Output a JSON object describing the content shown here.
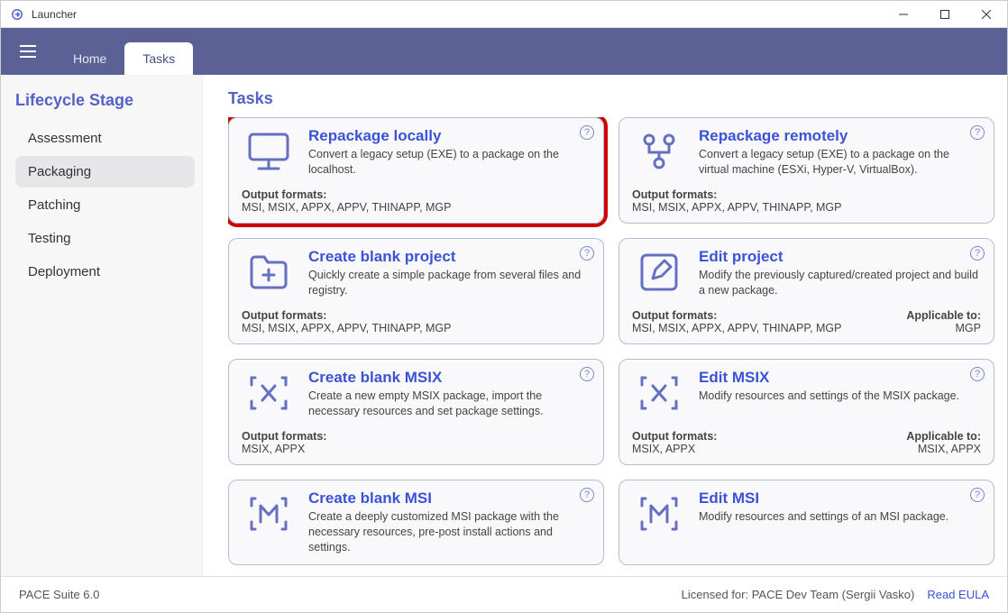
{
  "window": {
    "title": "Launcher"
  },
  "tabs": {
    "home": "Home",
    "tasks": "Tasks"
  },
  "sidebar": {
    "title": "Lifecycle Stage",
    "items": [
      {
        "label": "Assessment"
      },
      {
        "label": "Packaging"
      },
      {
        "label": "Patching"
      },
      {
        "label": "Testing"
      },
      {
        "label": "Deployment"
      }
    ]
  },
  "main": {
    "title": "Tasks",
    "labels": {
      "outputFormats": "Output formats:",
      "applicableTo": "Applicable to:"
    },
    "cards": [
      {
        "title": "Repackage locally",
        "desc": "Convert a legacy setup (EXE) to a package on the localhost.",
        "outputFormats": "MSI, MSIX, APPX, APPV, THINAPP, MGP",
        "applicableTo": ""
      },
      {
        "title": "Repackage remotely",
        "desc": "Convert a legacy setup (EXE) to a package on the virtual machine (ESXi, Hyper-V, VirtualBox).",
        "outputFormats": "MSI, MSIX, APPX, APPV, THINAPP, MGP",
        "applicableTo": ""
      },
      {
        "title": "Create blank project",
        "desc": "Quickly create a simple package from several files and registry.",
        "outputFormats": "MSI, MSIX, APPX, APPV, THINAPP, MGP",
        "applicableTo": ""
      },
      {
        "title": "Edit project",
        "desc": "Modify the previously captured/created project and build a new package.",
        "outputFormats": "MSI, MSIX, APPX, APPV, THINAPP, MGP",
        "applicableTo": "MGP"
      },
      {
        "title": "Create blank MSIX",
        "desc": "Create a new empty MSIX package, import the necessary resources and set package settings.",
        "outputFormats": "MSIX, APPX",
        "applicableTo": ""
      },
      {
        "title": "Edit MSIX",
        "desc": "Modify resources and settings of the MSIX package.",
        "outputFormats": "MSIX, APPX",
        "applicableTo": "MSIX, APPX"
      },
      {
        "title": "Create blank MSI",
        "desc": "Create a deeply customized MSI package with the necessary resources, pre-post install actions and settings.",
        "outputFormats": "",
        "applicableTo": ""
      },
      {
        "title": "Edit MSI",
        "desc": "Modify resources and settings of an MSI package.",
        "outputFormats": "",
        "applicableTo": ""
      }
    ]
  },
  "footer": {
    "version": "PACE Suite 6.0",
    "license": "Licensed for: PACE Dev Team (Sergii Vasko)",
    "eula": "Read EULA"
  }
}
